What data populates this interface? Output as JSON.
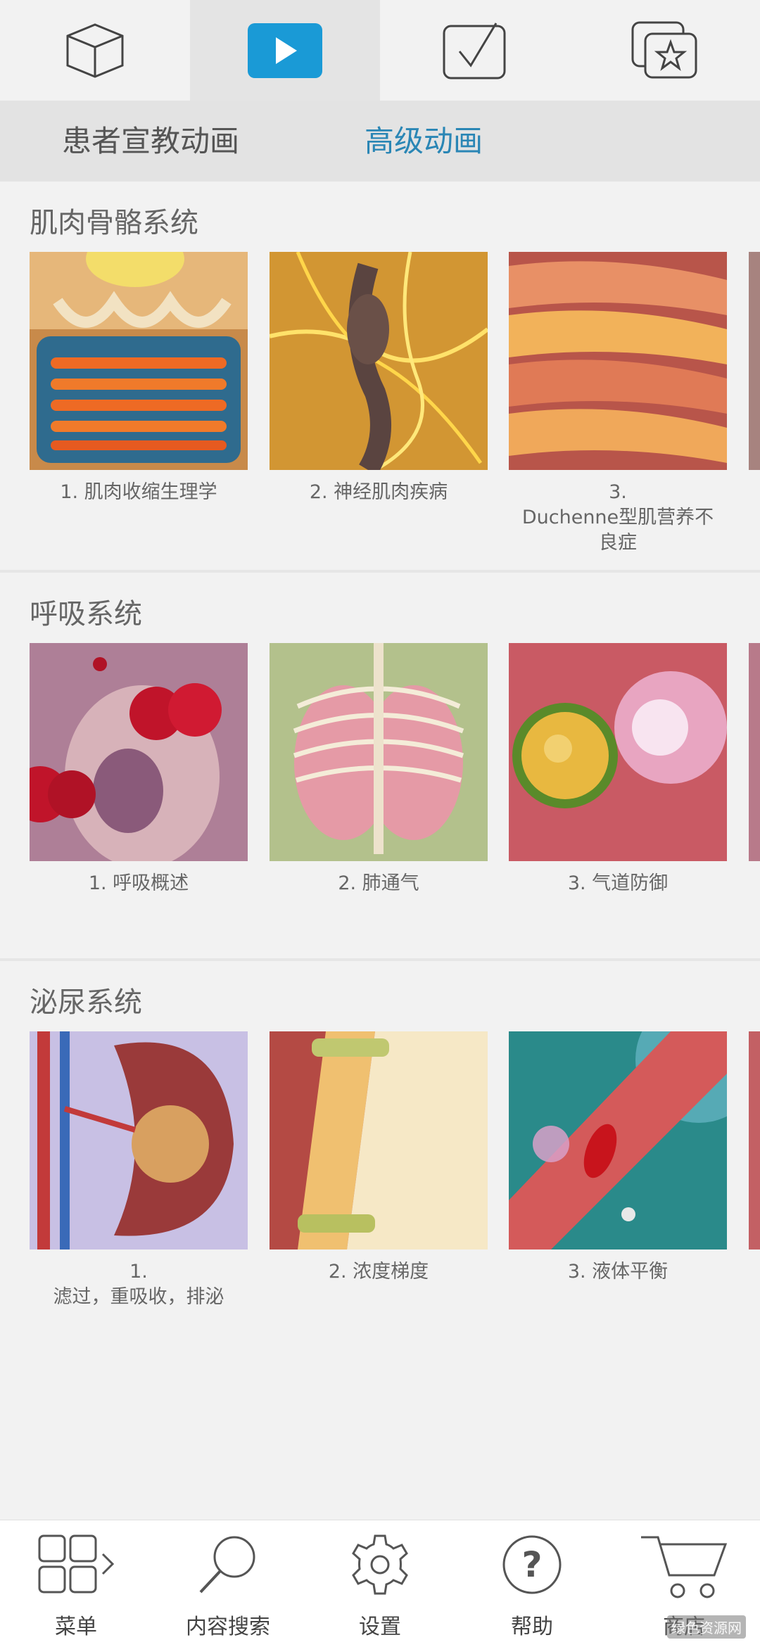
{
  "top_tabs": [
    {
      "icon": "cube-icon"
    },
    {
      "icon": "play-icon",
      "active": true
    },
    {
      "icon": "checkbox-icon"
    },
    {
      "icon": "star-cards-icon"
    }
  ],
  "sub_tabs": [
    {
      "label": "患者宣教动画",
      "active": false
    },
    {
      "label": "高级动画",
      "active": true
    }
  ],
  "sections": [
    {
      "title": "肌肉骨骼系统",
      "items": [
        {
          "caption": "1.  肌肉收缩生理学"
        },
        {
          "caption": "2.  神经肌肉疾病"
        },
        {
          "caption": "3.\nDuchenne型肌营养不\n良症"
        }
      ]
    },
    {
      "title": "呼吸系统",
      "items": [
        {
          "caption": "1.  呼吸概述"
        },
        {
          "caption": "2.  肺通气"
        },
        {
          "caption": "3.  气道防御"
        }
      ]
    },
    {
      "title": "泌尿系统",
      "items": [
        {
          "caption": "1.\n滤过，重吸收，排泌"
        },
        {
          "caption": "2.  浓度梯度"
        },
        {
          "caption": "3.  液体平衡"
        }
      ]
    }
  ],
  "bottom_nav": [
    {
      "label": "菜单",
      "icon": "menu-grid-icon"
    },
    {
      "label": "内容搜索",
      "icon": "search-icon"
    },
    {
      "label": "设置",
      "icon": "gear-icon"
    },
    {
      "label": "帮助",
      "icon": "help-icon"
    },
    {
      "label": "商店",
      "icon": "cart-icon"
    }
  ],
  "watermark": "绿色资源网",
  "colors": {
    "accent": "#2a86b5",
    "active_tab_bg": "#e4e4e4"
  }
}
